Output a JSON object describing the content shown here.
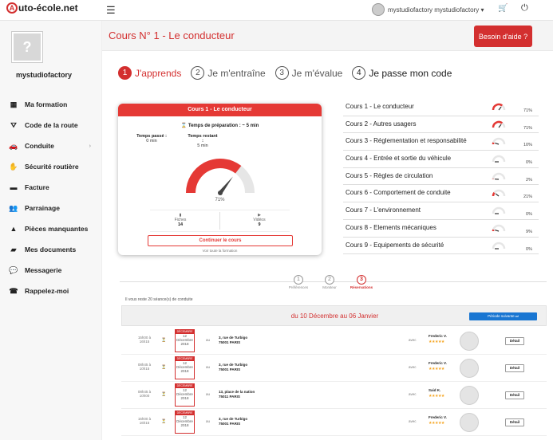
{
  "header": {
    "logo_a": "A",
    "logo_rest": "uto-école.net",
    "username": "mystudiofactory mystudiofactory",
    "user_caret": "▾"
  },
  "sidebar": {
    "username": "mystudiofactory",
    "items": [
      {
        "icon": "calendar-icon",
        "glyph": "▦",
        "label": "Ma formation"
      },
      {
        "icon": "road-icon",
        "glyph": "⛛",
        "label": "Code de la route"
      },
      {
        "icon": "car-icon",
        "glyph": "🚗",
        "label": "Conduite",
        "chevron": "›"
      },
      {
        "icon": "security-icon",
        "glyph": "✋",
        "label": "Sécurité routière"
      },
      {
        "icon": "invoice-icon",
        "glyph": "▬",
        "label": "Facture"
      },
      {
        "icon": "referral-icon",
        "glyph": "👥",
        "label": "Parrainage"
      },
      {
        "icon": "warning-icon",
        "glyph": "▲",
        "label": "Pièces manquantes"
      },
      {
        "icon": "folder-icon",
        "glyph": "▰",
        "label": "Mes documents"
      },
      {
        "icon": "messages-icon",
        "glyph": "💬",
        "label": "Messagerie"
      },
      {
        "icon": "phone-icon",
        "glyph": "☎",
        "label": "Rappelez-moi"
      }
    ]
  },
  "page": {
    "title": "Cours N° 1 - Le conducteur",
    "help_label": "Besoin d'aide ?"
  },
  "steps": [
    {
      "n": "1",
      "label": "J'apprends"
    },
    {
      "n": "2",
      "label": "Je m'entraîne"
    },
    {
      "n": "3",
      "label": "Je m'évalue"
    },
    {
      "n": "4",
      "label": "Je passe mon code"
    }
  ],
  "course_card": {
    "title": "Cours 1 - Le conducteur",
    "prep": "⌛ Temps de préparation : ~ 5 min",
    "time_spent_label": "Temps passé :",
    "time_spent": "0 min",
    "time_left_label": "Temps restant :",
    "time_left": "5 min",
    "gauge_percent": "71%",
    "gauge_value": 71,
    "fiches_label": "Fiches",
    "fiches": "14",
    "videos_label": "Vidéos",
    "videos": "9",
    "continue_label": "Continuer le cours",
    "see_all": "Voir toute la formation"
  },
  "courses": [
    {
      "label": "Cours 1 - Le conducteur",
      "pct": "71%",
      "value": 71
    },
    {
      "label": "Cours 2 - Autres usagers",
      "pct": "71%",
      "value": 71
    },
    {
      "label": "Cours 3 - Réglementation et responsabilité",
      "pct": "10%",
      "value": 10
    },
    {
      "label": "Cours 4 - Entrée et sortie du véhicule",
      "pct": "0%",
      "value": 0
    },
    {
      "label": "Cours 5 - Règles de circulation",
      "pct": "2%",
      "value": 2
    },
    {
      "label": "Cours 6 - Comportement de conduite",
      "pct": "21%",
      "value": 21
    },
    {
      "label": "Cours 7 - L'environnement",
      "pct": "0%",
      "value": 0
    },
    {
      "label": "Cours 8 - Elements mécaniques",
      "pct": "9%",
      "value": 9
    },
    {
      "label": "Cours 9 - Equipements de sécurité",
      "pct": "0%",
      "value": 0
    }
  ],
  "booking_tabs": [
    {
      "n": "1",
      "label": "Préférences"
    },
    {
      "n": "2",
      "label": "Moniteur"
    },
    {
      "n": "3",
      "label": "Réservations"
    }
  ],
  "remaining": "Il vous reste 20 séance(s) de conduite",
  "period": {
    "text": "du 10 Décembre au 06 Janvier",
    "next_label": "Période suivante ⏭"
  },
  "reservations": [
    {
      "time": "15h00 à 16h15",
      "month": "DÉCEMBRE",
      "day": "12",
      "month_name": "Décembre",
      "year": "2018",
      "au": "au",
      "address1": "3, rue de Turbigo",
      "address2": "75001 PARIS",
      "avec": "avec",
      "instructor": "Frederic V.",
      "stars": "★★★★★",
      "detail": "Détail"
    },
    {
      "time": "08h45 à 10h15",
      "month": "DÉCEMBRE",
      "day": "12",
      "month_name": "Décembre",
      "year": "2018",
      "au": "au",
      "address1": "3, rue de Turbigo",
      "address2": "75001 PARIS",
      "avec": "avec",
      "instructor": "Frederic V.",
      "stars": "★★★★★",
      "detail": "Détail"
    },
    {
      "time": "08h45 à 10h00",
      "month": "DÉCEMBRE",
      "day": "12",
      "month_name": "Décembre",
      "year": "2018",
      "au": "au",
      "address1": "13, place de la nation",
      "address2": "75011 PARIS",
      "avec": "avec",
      "instructor": "Said K.",
      "stars": "★★★★★",
      "detail": "Détail"
    },
    {
      "time": "15h00 à 16h15",
      "month": "DÉCEMBRE",
      "day": "12",
      "month_name": "Décembre",
      "year": "2018",
      "au": "au",
      "address1": "3, rue de Turbigo",
      "address2": "75001 PARIS",
      "avec": "avec",
      "instructor": "Frederic V.",
      "stars": "★★★★★",
      "detail": "Détail"
    }
  ],
  "colors": {
    "accent": "#d32f2f",
    "blue": "#1976d2"
  }
}
